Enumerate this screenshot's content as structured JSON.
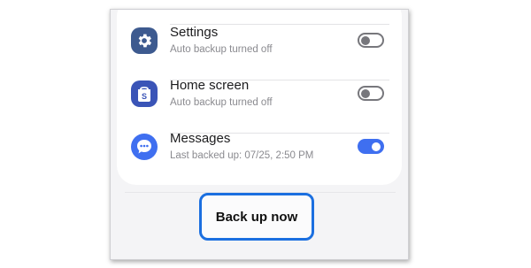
{
  "settings_list": {
    "items": [
      {
        "title": "Settings",
        "subtitle": "Auto backup turned off",
        "icon": "gear-icon",
        "icon_color": "#3d5a8f",
        "toggle_on": false
      },
      {
        "title": "Home screen",
        "subtitle": "Auto backup turned off",
        "icon": "home-screen-icon",
        "icon_color": "#3a54b7",
        "toggle_on": false
      },
      {
        "title": "Messages",
        "subtitle": "Last backed up: 07/25, 2:50 PM",
        "icon": "messages-icon",
        "icon_color": "#3f6ff0",
        "toggle_on": true
      }
    ]
  },
  "actions": {
    "backup_now_label": "Back up now"
  },
  "colors": {
    "accent": "#3f6ff0",
    "highlight_border": "#1b6fe0",
    "toggle_off": "#77777c"
  }
}
